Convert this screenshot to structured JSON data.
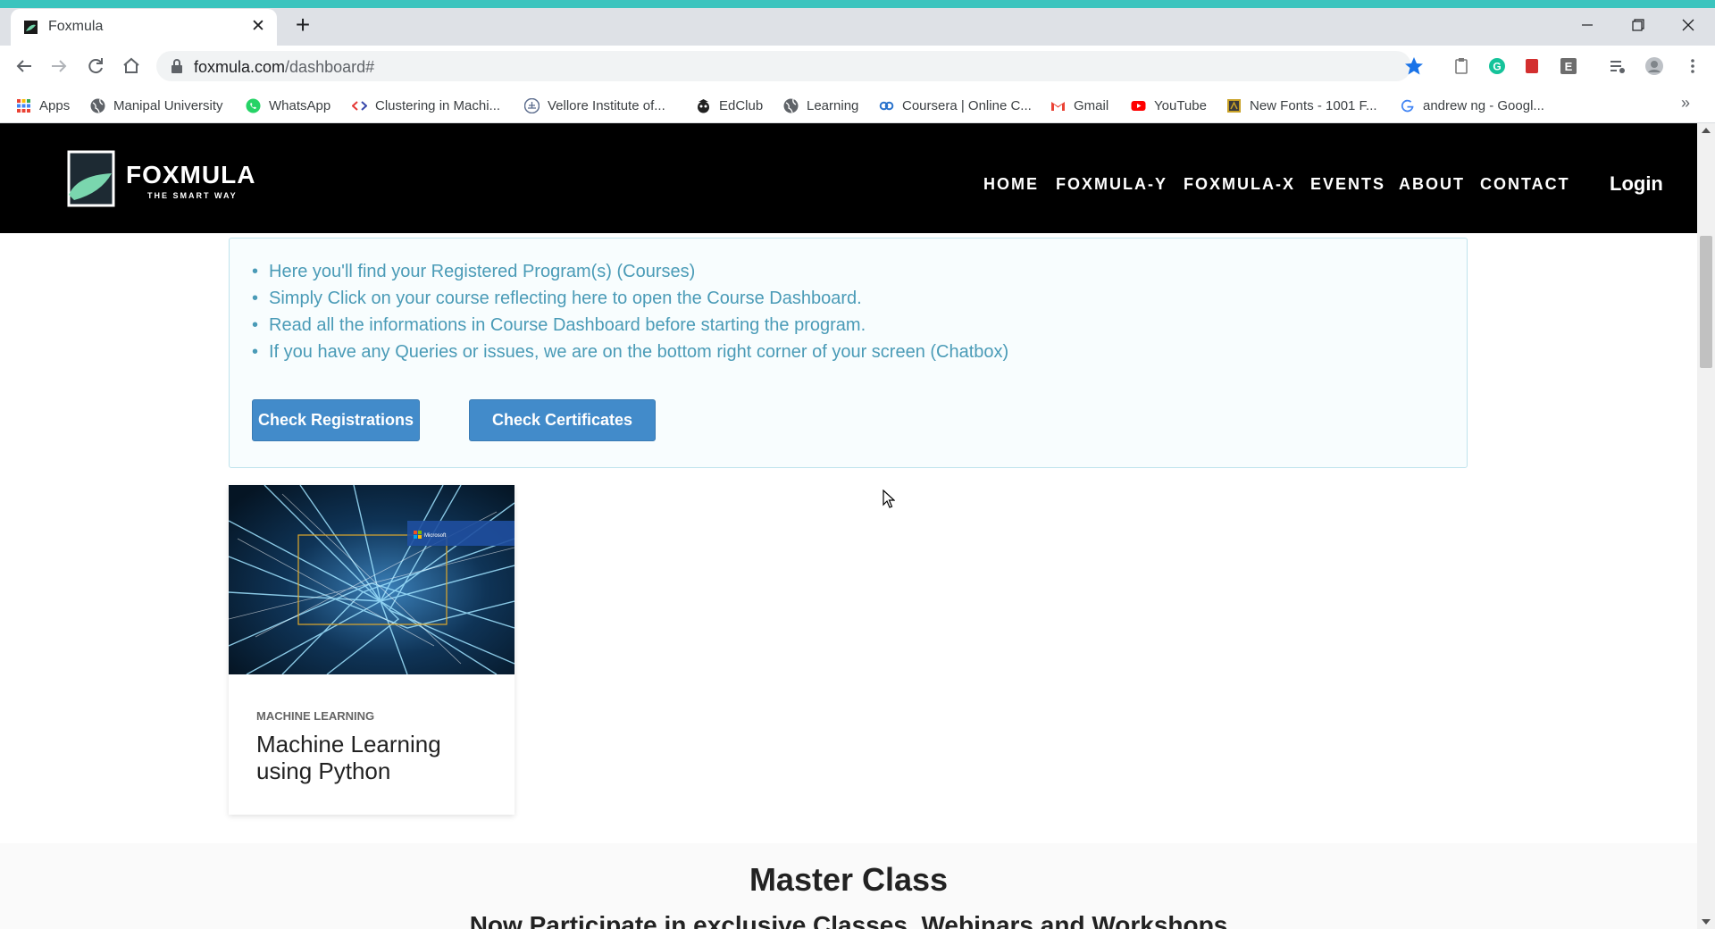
{
  "browser": {
    "tab_title": "Foxmula",
    "url_host": "foxmula.com",
    "url_path": "/dashboard#",
    "accent": "#3bc4be"
  },
  "bookmarks": [
    {
      "label": "Apps",
      "icon": "apps-grid-icon"
    },
    {
      "label": "Manipal University",
      "icon": "globe-icon"
    },
    {
      "label": "WhatsApp",
      "icon": "whatsapp-icon"
    },
    {
      "label": "Clustering in Machi...",
      "icon": "code-icon"
    },
    {
      "label": "Vellore Institute of...",
      "icon": "institute-icon"
    },
    {
      "label": "EdClub",
      "icon": "edclub-icon"
    },
    {
      "label": "Learning",
      "icon": "globe-icon"
    },
    {
      "label": "Coursera | Online C...",
      "icon": "coursera-icon"
    },
    {
      "label": "Gmail",
      "icon": "gmail-icon"
    },
    {
      "label": "YouTube",
      "icon": "youtube-icon"
    },
    {
      "label": "New Fonts - 1001 F...",
      "icon": "fonts-icon"
    },
    {
      "label": "andrew ng - Googl...",
      "icon": "google-icon"
    }
  ],
  "site": {
    "logo_name": "FOXMULA",
    "logo_tagline": "THE SMART WAY",
    "menu": [
      "HOME",
      "FOXMULA-Y",
      "FOXMULA-X",
      "EVENTS",
      "ABOUT",
      "CONTACT"
    ],
    "login": "Login"
  },
  "info": {
    "items": [
      "Here you'll find your Registered Program(s) (Courses)",
      "Simply Click on your course reflecting here to open the Course Dashboard.",
      "Read all the informations in Course Dashboard before starting the program.",
      "If you have any Queries or issues, we are on the bottom right corner of your screen (Chatbox)"
    ],
    "check_registrations": "Check Registrations",
    "check_certificates": "Check Certificates"
  },
  "course": {
    "category": "MACHINE LEARNING",
    "title": "Machine Learning using Python",
    "badge_brand": "Microsoft"
  },
  "master": {
    "title": "Master Class",
    "subtitle": "Now Participate in exclusive Classes, Webinars and Workshops"
  }
}
